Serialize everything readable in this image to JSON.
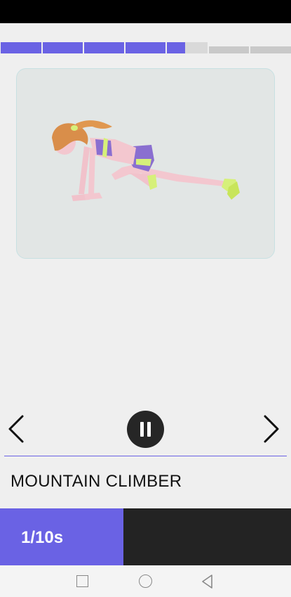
{
  "colors": {
    "accent": "#6a62e4",
    "dark": "#232323",
    "status_bar": "#000000"
  },
  "progress": {
    "segments_total": 7,
    "segments_complete": 4,
    "current_segment_fraction": 0.45
  },
  "exercise": {
    "name": "MOUNTAIN CLIMBER",
    "illustration": "woman-mountain-climber-illustration"
  },
  "controls": {
    "prev_icon": "chevron-left-icon",
    "pause_icon": "pause-icon",
    "next_icon": "chevron-right-icon"
  },
  "timer": {
    "text": "1/10s"
  },
  "system_nav": {
    "recents_icon": "square-icon",
    "home_icon": "circle-icon",
    "back_icon": "triangle-back-icon"
  }
}
